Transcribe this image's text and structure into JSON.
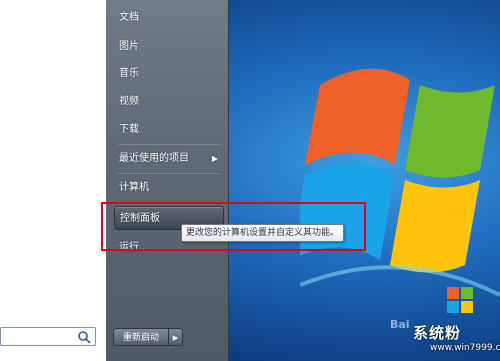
{
  "start_menu": {
    "right_items": [
      {
        "label": "文档"
      },
      {
        "label": "图片"
      },
      {
        "label": "音乐"
      },
      {
        "label": "视频"
      },
      {
        "label": "下载"
      },
      {
        "label": "最近使用的项目"
      },
      {
        "label": "计算机"
      },
      {
        "label": "控制面板"
      },
      {
        "label": "运行..."
      }
    ],
    "shutdown_label": "重新启动",
    "search_icon": "search-icon"
  },
  "tooltip": {
    "text": "更改您的计算机设置并自定义其功能。"
  },
  "watermark": {
    "baidu": "Bai",
    "site": "系统粉",
    "url": "www.win7999.com"
  },
  "colors": {
    "annotation": "#e3001b",
    "menu_right_pane": "#5f6b77",
    "desktop": "#1f6cbf"
  }
}
